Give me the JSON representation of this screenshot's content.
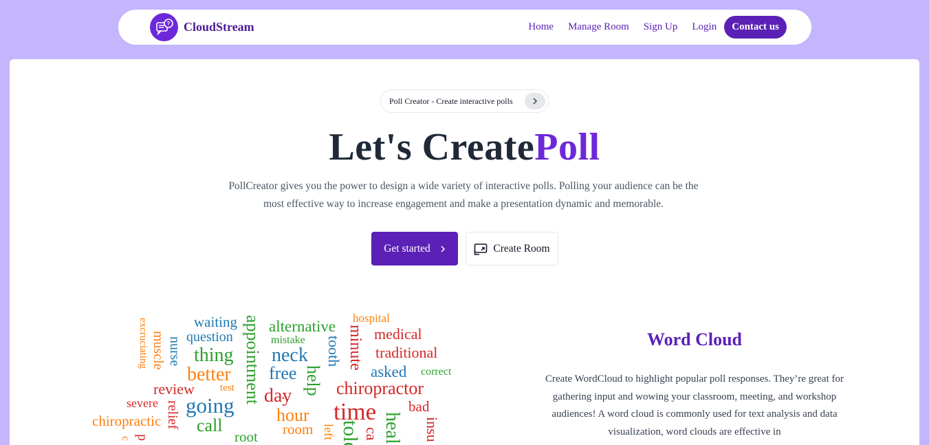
{
  "navbar": {
    "brand": "CloudStream",
    "links": [
      "Home",
      "Manage Room",
      "Sign Up",
      "Login"
    ],
    "contact": "Contact us"
  },
  "hero": {
    "pill_text": "Poll Creator - Create interactive polls",
    "title_main": "Let's Create",
    "title_accent": "Poll",
    "description": "PollCreator gives you the power to design a wide variety of interactive polls. Polling your audience can be the most effective way to increase engagement and make a presentation dynamic and memorable.",
    "primary_button": "Get started",
    "secondary_button": "Create Room"
  },
  "wordcloud_section": {
    "title": "Word Cloud",
    "description": "Create WordCloud to highlight popular poll responses. They’re great for gathering input and wowing your classroom, meeting, and workshop audiences! A word cloud is commonly used for text analysis and data visualization, word clouds are effective in"
  },
  "wordcloud_words": {
    "excruciating": "excruciating",
    "muscle": "muscle",
    "nurse": "nurse",
    "waiting": "waiting",
    "question": "question",
    "thing": "thing",
    "better": "better",
    "appointment": "appointment",
    "alternative": "alternative",
    "mistake": "mistake",
    "neck": "neck",
    "free": "free",
    "help": "help",
    "tooth": "tooth",
    "minute": "minute",
    "hospital": "hospital",
    "medical": "medical",
    "traditional": "traditional",
    "asked": "asked",
    "correct": "correct",
    "review": "review",
    "test": "test",
    "severe": "severe",
    "relief": "relief",
    "going": "going",
    "call": "call",
    "chiropractic": "chiropractic",
    "day": "day",
    "hour": "hour",
    "room": "room",
    "root": "root",
    "chiropractor": "chiropractor",
    "time": "time",
    "bad": "bad",
    "told": "told",
    "left": "left",
    "heal": "heal",
    "ca": "ca",
    "insu": "insu",
    "p": "p",
    "c": "c",
    "dot": "."
  },
  "colors": {
    "accent": "#6d28d9",
    "primary_button": "#5b21b6",
    "background": "#c4b5fd"
  }
}
